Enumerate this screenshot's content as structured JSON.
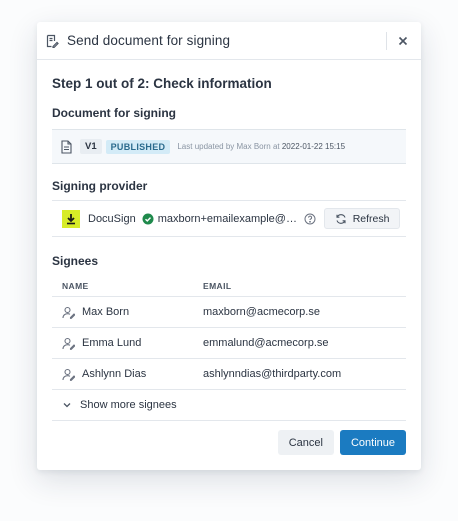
{
  "dialog": {
    "title": "Send document for signing",
    "step_title": "Step 1 out of 2: Check information"
  },
  "document": {
    "section_title": "Document for signing",
    "version": "V1",
    "status": "PUBLISHED",
    "updated_prefix": "Last updated by Max Born at ",
    "updated_at": "2022-01-22 15:15"
  },
  "provider": {
    "section_title": "Signing provider",
    "name": "DocuSign",
    "account": "maxborn+emailexample@acmecorp.se",
    "refresh_label": "Refresh"
  },
  "signees": {
    "section_title": "Signees",
    "columns": [
      "NAME",
      "EMAIL"
    ],
    "rows": [
      {
        "name": "Max Born",
        "email": "maxborn@acmecorp.se"
      },
      {
        "name": "Emma Lund",
        "email": "emmalund@acmecorp.se"
      },
      {
        "name": "Ashlynn Dias",
        "email": "ashlynndias@thirdparty.com"
      }
    ],
    "show_more_label": "Show more signees"
  },
  "footer": {
    "cancel_label": "Cancel",
    "continue_label": "Continue"
  },
  "colors": {
    "primary": "#1b7bc1",
    "published_badge": "#d3ebf7",
    "docusign_logo": "#d7ec27",
    "verified": "#1f8a4c"
  }
}
